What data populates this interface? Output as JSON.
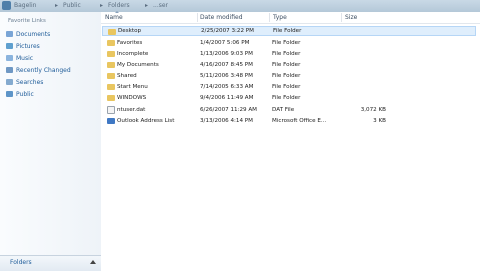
{
  "titlebar": {
    "segments": [
      "Bagelin",
      "Public",
      "Folders",
      "...ser"
    ]
  },
  "nav": {
    "heading": "Favorite Links",
    "items": [
      {
        "label": "Documents",
        "icon": "documents-icon"
      },
      {
        "label": "Pictures",
        "icon": "pictures-icon"
      },
      {
        "label": "Music",
        "icon": "music-icon"
      },
      {
        "label": "Recently Changed",
        "icon": "recent-icon"
      },
      {
        "label": "Searches",
        "icon": "search-icon"
      },
      {
        "label": "Public",
        "icon": "public-folder-icon"
      }
    ],
    "folders_label": "Folders"
  },
  "columns": {
    "name": "Name",
    "date": "Date modified",
    "type": "Type",
    "size": "Size"
  },
  "files": [
    {
      "name": "Desktop",
      "date": "2/25/2007 3:22 PM",
      "type": "File Folder",
      "size": "",
      "icon": "folder-icon",
      "selected": true
    },
    {
      "name": "Favorites",
      "date": "1/4/2007 5:06 PM",
      "type": "File Folder",
      "size": "",
      "icon": "folder-icon"
    },
    {
      "name": "Incomplete",
      "date": "1/13/2006 9:03 PM",
      "type": "File Folder",
      "size": "",
      "icon": "folder-icon"
    },
    {
      "name": "My Documents",
      "date": "4/16/2007 8:45 PM",
      "type": "File Folder",
      "size": "",
      "icon": "folder-icon"
    },
    {
      "name": "Shared",
      "date": "5/11/2006 3:48 PM",
      "type": "File Folder",
      "size": "",
      "icon": "folder-icon"
    },
    {
      "name": "Start Menu",
      "date": "7/14/2005 6:33 AM",
      "type": "File Folder",
      "size": "",
      "icon": "folder-icon"
    },
    {
      "name": "WINDOWS",
      "date": "9/4/2006 11:49 AM",
      "type": "File Folder",
      "size": "",
      "icon": "folder-icon"
    },
    {
      "name": "ntuser.dat",
      "date": "6/26/2007 11:29 AM",
      "type": "DAT File",
      "size": "3,072 KB",
      "icon": "file-icon"
    },
    {
      "name": "Outlook Address List",
      "date": "3/13/2006 4:14 PM",
      "type": "Microsoft Office E...",
      "size": "3 KB",
      "icon": "outlook-icon"
    }
  ]
}
